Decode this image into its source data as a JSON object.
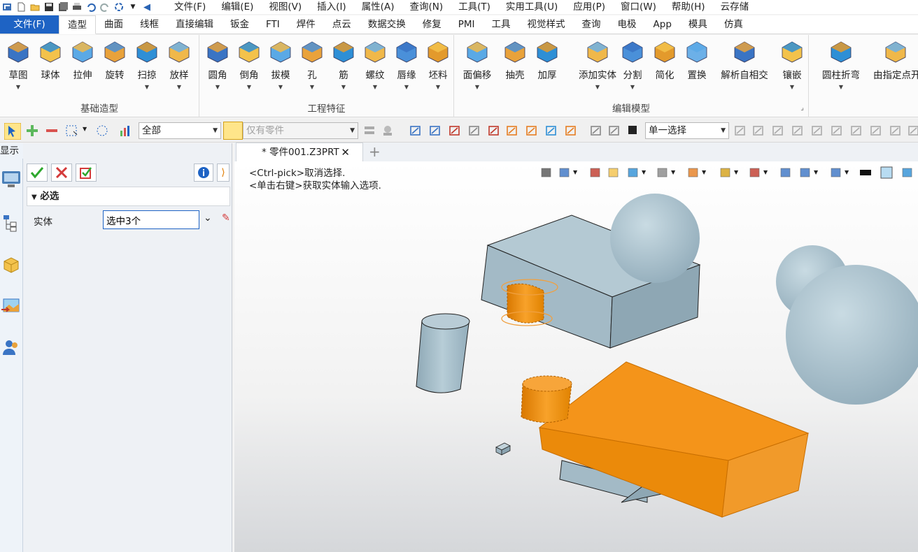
{
  "quick_access": [
    "app-icon",
    "new-icon",
    "open-icon",
    "save-icon",
    "save-all-icon",
    "print-icon",
    "undo-icon",
    "redo-icon",
    "refresh-icon"
  ],
  "menu": [
    "文件(F)",
    "编辑(E)",
    "视图(V)",
    "插入(I)",
    "属性(A)",
    "查询(N)",
    "工具(T)",
    "实用工具(U)",
    "应用(P)",
    "窗口(W)",
    "帮助(H)",
    "云存储"
  ],
  "ribbon_tabs": {
    "file": "文件(F)",
    "tabs": [
      "造型",
      "曲面",
      "线框",
      "直接编辑",
      "钣金",
      "FTI",
      "焊件",
      "点云",
      "数据交换",
      "修复",
      "PMI",
      "工具",
      "视觉样式",
      "查询",
      "电极",
      "App",
      "模具",
      "仿真"
    ],
    "active": "造型"
  },
  "groups": {
    "basic": {
      "title": "基础造型",
      "buttons": [
        "草图",
        "球体",
        "拉伸",
        "旋转",
        "扫掠",
        "放样"
      ]
    },
    "eng": {
      "title": "工程特征",
      "buttons": [
        "圆角",
        "倒角",
        "拔模",
        "孔",
        "筋",
        "螺纹",
        "唇缘",
        "坯料"
      ]
    },
    "edit": {
      "title": "编辑模型",
      "buttons": [
        "面偏移",
        "抽壳",
        "加厚",
        "添加实体",
        "分割",
        "简化",
        "置换",
        "解析自相交",
        "镶嵌"
      ]
    },
    "extra": {
      "buttons": [
        "圆柱折弯",
        "由指定点开"
      ]
    }
  },
  "selbar": {
    "filter": "全部",
    "scope": "仅有零件",
    "mode": "单一选择"
  },
  "panel": {
    "header": "显示",
    "section": "必选",
    "field_label": "实体",
    "field_value": "选中3个"
  },
  "document": {
    "tab": "* 零件001.Z3PRT"
  },
  "hint": [
    "<Ctrl-pick>取消选择.",
    "<单击右键>获取实体输入选项."
  ],
  "colors": {
    "accent": "#1e63c4",
    "selected": "#f08c00",
    "body": "#a9bfc9"
  }
}
